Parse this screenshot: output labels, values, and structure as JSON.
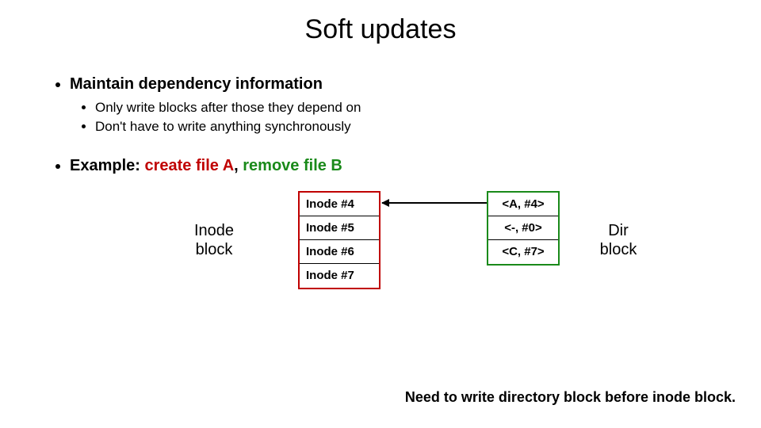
{
  "title": "Soft updates",
  "bullets": {
    "maintain": "Maintain dependency information",
    "only_write": "Only write blocks after those they depend on",
    "dont_have": "Don't have to write anything synchronously",
    "example_prefix": "Example: ",
    "example_create": "create file A",
    "example_sep": ", ",
    "example_remove": "remove file B"
  },
  "inode_block_label": "Inode\nblock",
  "dir_block_label": "Dir\nblock",
  "inode_cells": [
    "Inode #4",
    "Inode #5",
    "Inode #6",
    "Inode #7"
  ],
  "dir_cells": [
    "<A, #4>",
    "<-, #0>",
    "<C, #7>"
  ],
  "footnote": "Need to write directory block before inode block."
}
